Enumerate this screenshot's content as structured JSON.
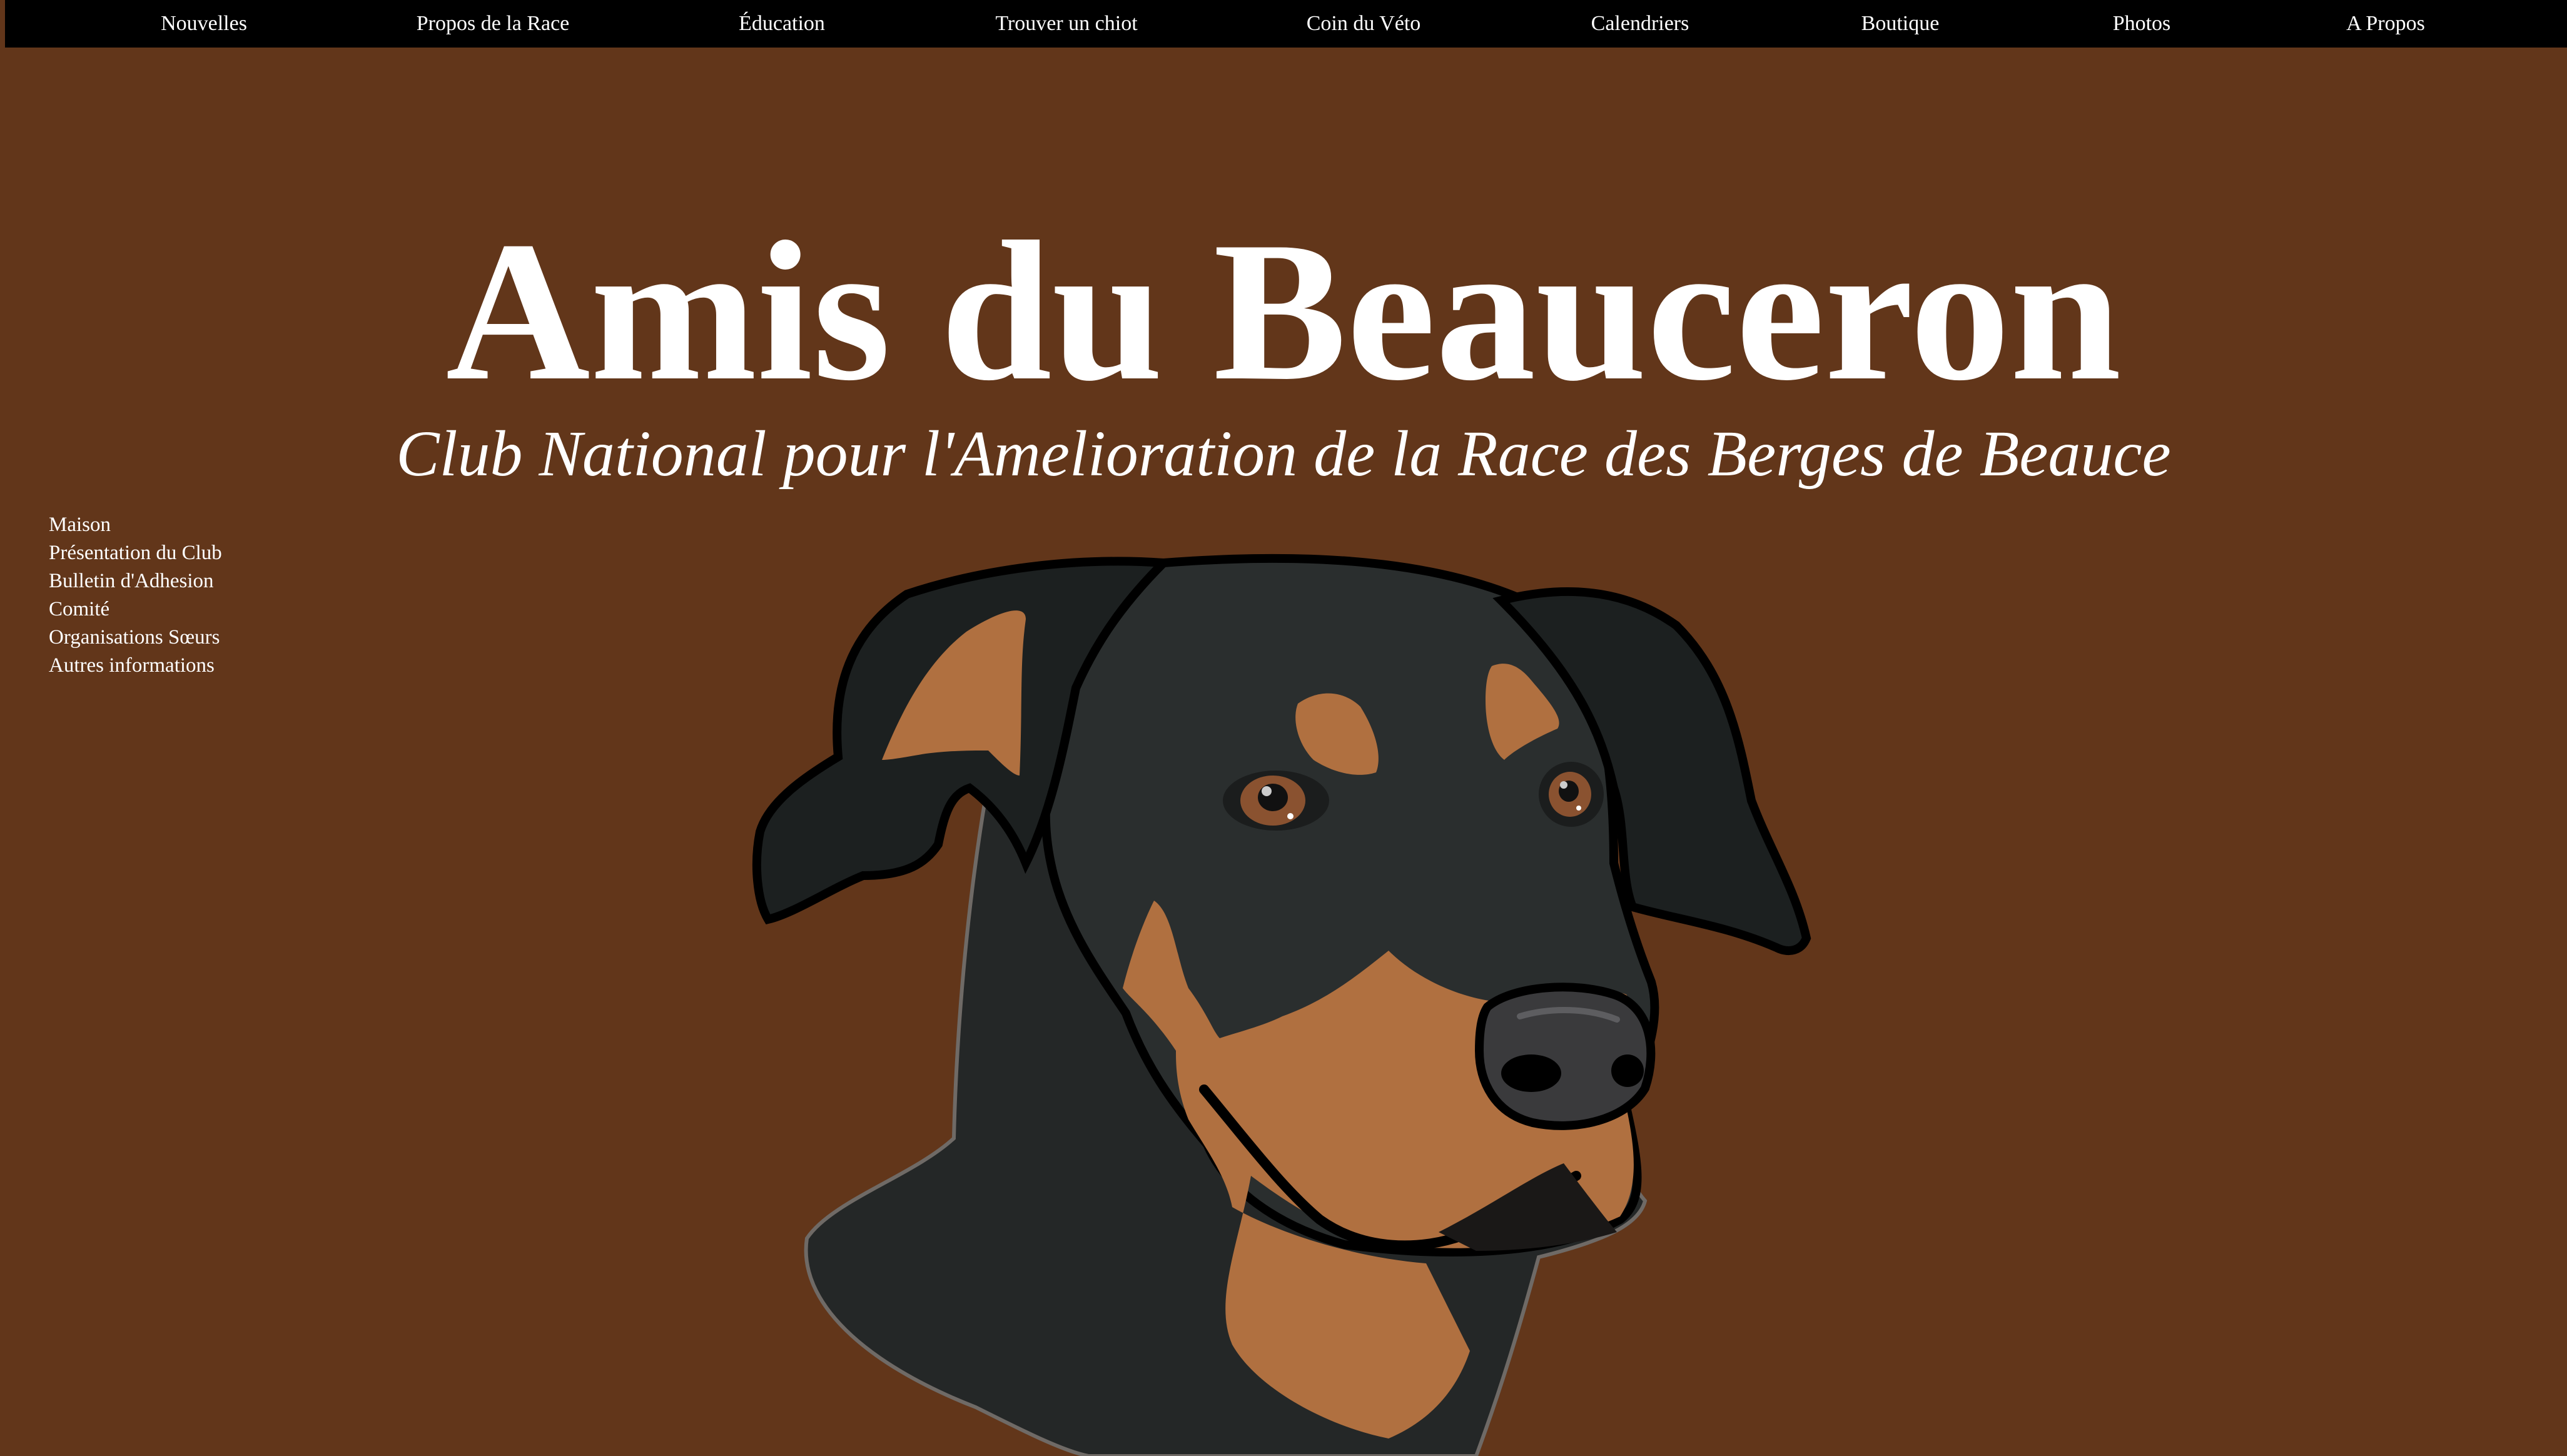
{
  "topnav": {
    "items": [
      {
        "label": "Nouvelles"
      },
      {
        "label": "Propos de la Race"
      },
      {
        "label": "Éducation"
      },
      {
        "label": "Trouver un chiot"
      },
      {
        "label": "Coin du Véto"
      },
      {
        "label": "Calendriers"
      },
      {
        "label": "Boutique"
      },
      {
        "label": "Photos"
      },
      {
        "label": "A Propos"
      }
    ]
  },
  "header": {
    "title": "Amis du Beauceron",
    "subtitle": "Club National pour l'Amelioration de la Race des Berges de Beauce"
  },
  "sidenav": {
    "items": [
      {
        "label": "Maison"
      },
      {
        "label": "Présentation du Club"
      },
      {
        "label": "Bulletin d'Adhesion"
      },
      {
        "label": "Comité"
      },
      {
        "label": "Organisations Sœurs"
      },
      {
        "label": "Autres informations"
      }
    ]
  },
  "illustration": {
    "icon": "beauceron-dog-head-illustration"
  },
  "colors": {
    "background": "#62361a",
    "nav_background": "#000000",
    "text": "#ffffff",
    "dog_black": "#242727",
    "dog_tan": "#b07040"
  }
}
